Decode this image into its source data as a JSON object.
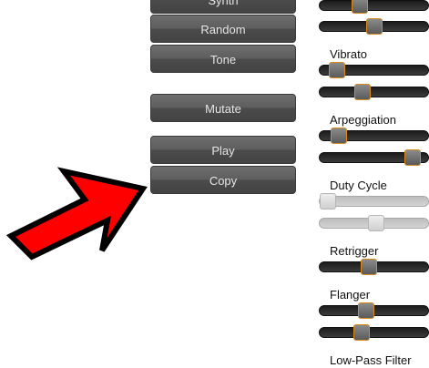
{
  "buttons": {
    "synth": "Synth",
    "random": "Random",
    "tone": "Tone",
    "mutate": "Mutate",
    "play": "Play",
    "copy": "Copy"
  },
  "sections": [
    {
      "key": "top",
      "label": "",
      "sliders": [
        0.35,
        0.5
      ]
    },
    {
      "key": "vibrato",
      "label": "Vibrato",
      "sliders": [
        0.1,
        0.38
      ]
    },
    {
      "key": "arpeggiation",
      "label": "Arpeggiation",
      "sliders": [
        0.12,
        0.92
      ]
    },
    {
      "key": "duty-cycle",
      "label": "Duty Cycle",
      "sliders": [
        0.0,
        0.52
      ],
      "disabled": true
    },
    {
      "key": "retrigger",
      "label": "Retrigger",
      "sliders": [
        0.45
      ]
    },
    {
      "key": "flanger",
      "label": "Flanger",
      "sliders": [
        0.42,
        0.37
      ]
    },
    {
      "key": "low-pass-filter",
      "label": "Low-Pass Filter",
      "sliders": []
    }
  ],
  "colors": {
    "arrow_fill": "#ff0000",
    "arrow_outline": "#000000",
    "thumb_border": "#d98a1f",
    "button_text": "#e6e6e6"
  },
  "icons": {
    "pointer": "red-arrow-icon"
  }
}
